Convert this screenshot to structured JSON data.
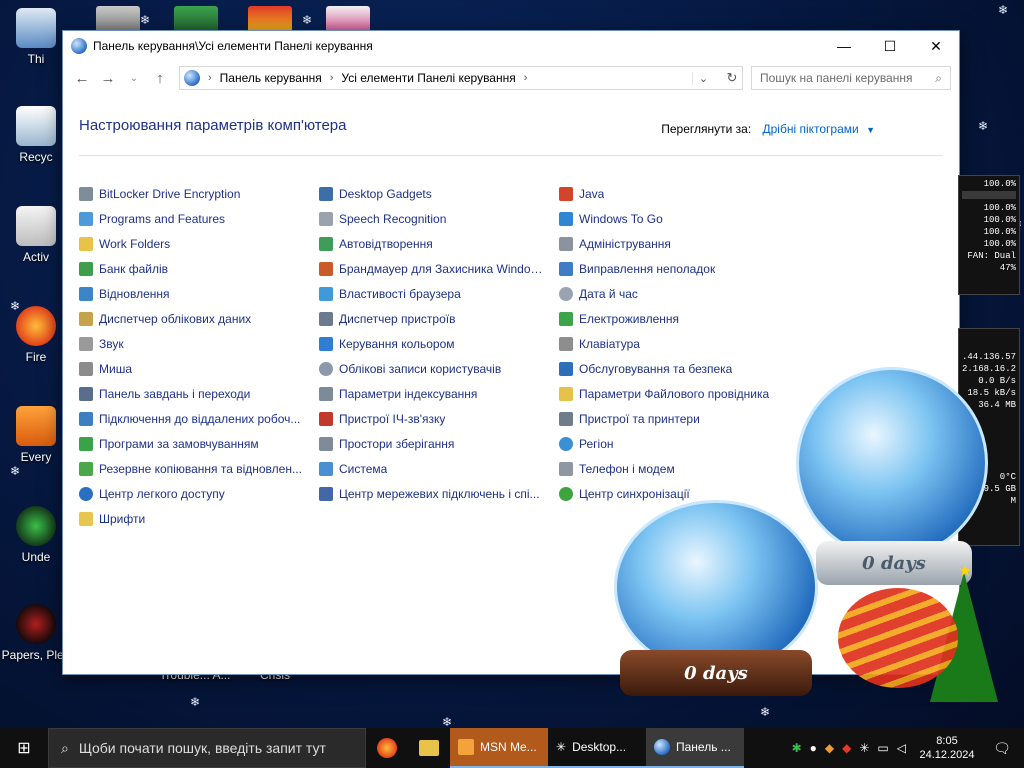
{
  "window": {
    "title": "Панель керування\\Усі елементи Панелі керування",
    "minimize": "—",
    "maximize": "☐",
    "close": "✕"
  },
  "nav": {
    "back": "←",
    "forward": "→",
    "recent": "⌄",
    "up": "↑"
  },
  "address": {
    "crumbs": [
      "Панель керування",
      "Усі елементи Панелі керування"
    ],
    "separator": "›",
    "dropdown": "⌄",
    "refresh": "↻"
  },
  "search": {
    "placeholder": "Пошук на панелі керування",
    "icon": "⌕"
  },
  "main": {
    "heading": "Настроювання параметрів комп'ютера",
    "view_label": "Переглянути за:",
    "view_value": "Дрібні піктограми",
    "view_caret": "▼"
  },
  "items": {
    "col1": [
      "BitLocker Drive Encryption",
      "Programs and Features",
      "Work Folders",
      "Банк файлів",
      "Відновлення",
      "Диспетчер облікових даних",
      "Звук",
      "Миша",
      "Панель завдань і переходи",
      "Підключення до віддалених робоч...",
      "Програми за замовчуванням",
      "Резервне копіювання та відновлен...",
      "Центр легкого доступу",
      "Шрифти"
    ],
    "col2": [
      "Desktop Gadgets",
      "Speech Recognition",
      "Автовідтворення",
      "Брандмауер для Захисника Windows",
      "Властивості браузера",
      "Диспетчер пристроїв",
      "Керування кольором",
      "Облікові записи користувачів",
      "Параметри індексування",
      "Пристрої ІЧ-зв'язку",
      "Простори зберігання",
      "Система",
      "Центр мережевих підключень і спі..."
    ],
    "col3": [
      "Java",
      "Windows To Go",
      "Адміністрування",
      "Виправлення неполадок",
      "Дата й час",
      "Електроживлення",
      "Клавіатура",
      "Обслуговування та безпека",
      "Параметри Файлового провідника",
      "Пристрої та принтери",
      "Регіон",
      "Телефон і модем",
      "Центр синхронізації"
    ]
  },
  "desktop_icons": [
    {
      "label": "Thi"
    },
    {
      "label": "Recyc"
    },
    {
      "label": "Activ"
    },
    {
      "label": "Fire"
    },
    {
      "label": "Every"
    },
    {
      "label": "Unde"
    },
    {
      "label": "Papers, Plea"
    }
  ],
  "desktop_bottom_labels": [
    "Trouble... A...",
    "Crisis"
  ],
  "gadget_cpu": {
    "lines": [
      "100.0%",
      "100.0%",
      "100.0%",
      "100.0%",
      "100.0%",
      "FAN: Dual",
      "47%"
    ]
  },
  "gadget_net": {
    "lines": [
      ".44.136.57",
      "2.168.16.2",
      "0.0 B/s",
      "18.5 kB/s",
      "36.4 MB"
    ],
    "temp": "0°C",
    "storage": "9.5 GB",
    "extra": "M"
  },
  "globes": {
    "left_label": "0 days",
    "right_label": "0 days"
  },
  "taskbar": {
    "start": "⊞",
    "search_icon": "⌕",
    "search_placeholder": "Щоби почати пошук, введіть запит тут",
    "apps": [
      {
        "label": "MSN Me..."
      },
      {
        "label": "Desktop..."
      },
      {
        "label": "Панель ..."
      }
    ],
    "time": "8:05",
    "date": "24.12.2024",
    "notifications": "🗨"
  },
  "colors": {
    "link": "#1e3287",
    "accent": "#0066cc",
    "desktop": "#061a45",
    "taskbar": "#101010"
  }
}
